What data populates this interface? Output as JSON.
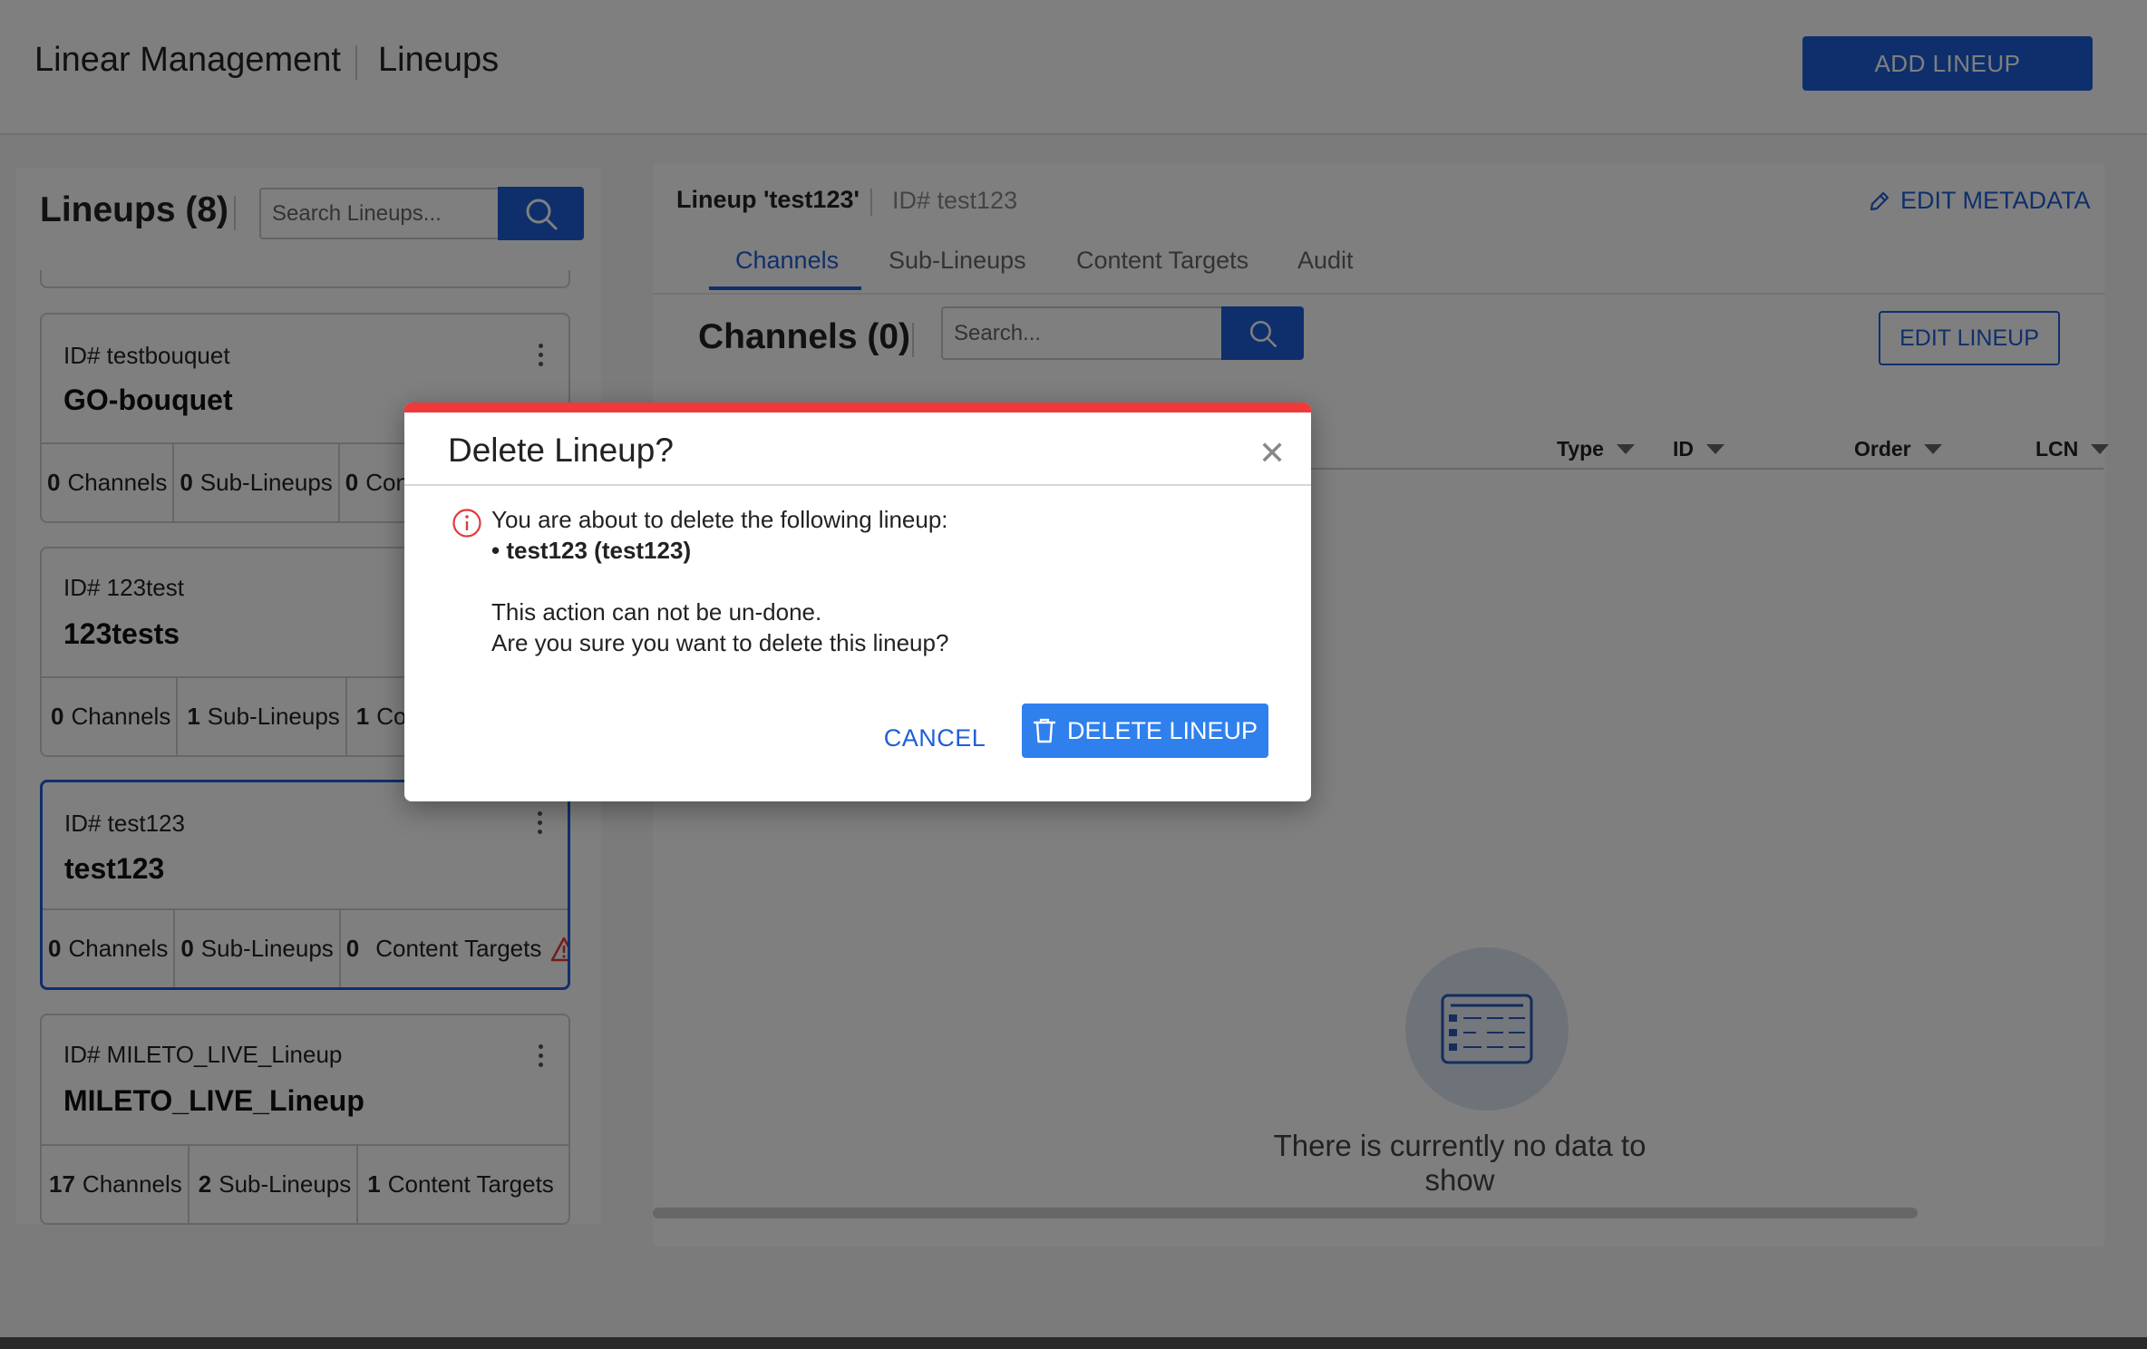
{
  "header": {
    "title": "Linear Management",
    "section": "Lineups",
    "add_button": "ADD LINEUP"
  },
  "left_panel": {
    "title": "Lineups (8)",
    "search_placeholder": "Search Lineups...",
    "cards": [
      {
        "id_label": "ID# testbouquet",
        "name": "GO-bouquet",
        "channels_count": "0",
        "channels_label": "Channels",
        "sublineups_count": "0",
        "sublineups_label": "Sub-Lineups",
        "targets_count": "0",
        "targets_label": "Con"
      },
      {
        "id_label": "ID# 123test",
        "name": "123tests",
        "channels_count": "0",
        "channels_label": "Channels",
        "sublineups_count": "1",
        "sublineups_label": "Sub-Lineups",
        "targets_count": "1",
        "targets_label": "Co"
      },
      {
        "id_label": "ID# test123",
        "name": "test123",
        "channels_count": "0",
        "channels_label": "Channels",
        "sublineups_count": "0",
        "sublineups_label": "Sub-Lineups",
        "targets_count": "0",
        "targets_label": "Content Targets"
      },
      {
        "id_label": "ID# MILETO_LIVE_Lineup",
        "name": "MILETO_LIVE_Lineup",
        "channels_count": "17",
        "channels_label": "Channels",
        "sublineups_count": "2",
        "sublineups_label": "Sub-Lineups",
        "targets_count": "1",
        "targets_label": "Content Targets"
      }
    ]
  },
  "detail": {
    "title": "Lineup 'test123'",
    "id_label": "ID# test123",
    "edit_metadata": "EDIT METADATA",
    "tabs": [
      "Channels",
      "Sub-Lineups",
      "Content Targets",
      "Audit"
    ],
    "active_tab": "Channels",
    "channels_title": "Channels (0)",
    "search_placeholder": "Search...",
    "edit_lineup": "EDIT LINEUP",
    "columns": [
      "Type",
      "ID",
      "Order",
      "LCN"
    ],
    "empty_text": "There is currently no data to show"
  },
  "modal": {
    "title": "Delete Lineup?",
    "line1": "You are about to delete the following lineup:",
    "item": "• test123 (test123)",
    "line2": "This action can not be un-done.",
    "line3": "Are you sure you want to delete this lineup?",
    "cancel": "CANCEL",
    "delete": "DELETE LINEUP"
  },
  "colors": {
    "primary": "#1f5fd8",
    "danger_bar": "#f0393a",
    "delete_button": "#2f80ed",
    "warning": "#e03a3a"
  }
}
